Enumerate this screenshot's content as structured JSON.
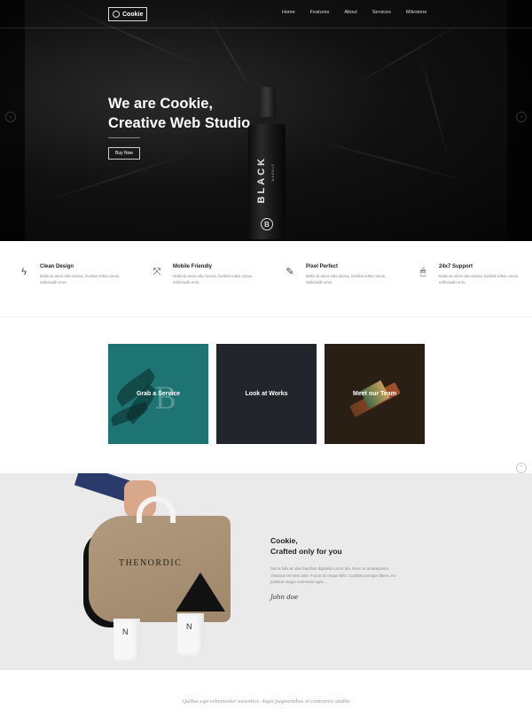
{
  "header": {
    "logo_text": "Cookie",
    "nav": [
      "Home",
      "Features",
      "About",
      "Services",
      "Milestone"
    ]
  },
  "hero": {
    "title_line1": "We are Cookie,",
    "title_line2": "Creative Web Studio",
    "button": "Buy Now",
    "bottle_label": "BLACK",
    "bottle_sub": "MARBLE",
    "bottle_mark": "B"
  },
  "features": [
    {
      "icon": "lightning-icon",
      "glyph": "ϟ",
      "title": "Clean Design",
      "text": "Nulla sit amet odio lacinia, facilisis tellus nonus, sollicitudin eros."
    },
    {
      "icon": "expand-icon",
      "glyph": "⤧",
      "title": "Mobile Friendly",
      "text": "Nulla sit amet odio lacinia, facilisis tellus nonus, sollicitudin eros."
    },
    {
      "icon": "pencil-icon",
      "glyph": "✎",
      "title": "Pixel Perfect",
      "text": "Nulla sit amet odio lacinia, facilisis tellus nonus, sollicitudin eros."
    },
    {
      "icon": "mouse-icon",
      "glyph": "🖱",
      "title": "24x7 Support",
      "text": "Nulla sit amet odio lacinia, facilisis tellus nonus, sollicitudin eros."
    }
  ],
  "tiles": [
    {
      "label": "Grab a Service",
      "color": "#1e7373"
    },
    {
      "label": "Look at Works",
      "color": "#22252b"
    },
    {
      "label": "Meet our Team",
      "color": "#2a1f14"
    }
  ],
  "about": {
    "title_line1": "Cookie,",
    "title_line2": "Crafted only for you",
    "text": "Sed a felis at odio faucibus dignissim at ac dui. Nunc et ornareipsum. Vivamus vel sem ante. Fusce ac neque felis. Curabitur tempus libero, eu pulvinar neque commodo eget...",
    "signature": "John doe",
    "bag_brand": "THENORDIC",
    "cup_mark": "N"
  },
  "quote": {
    "text": "Quibus ego vehementer assentior. Atqui pugnantibus et contrariis studiis"
  }
}
